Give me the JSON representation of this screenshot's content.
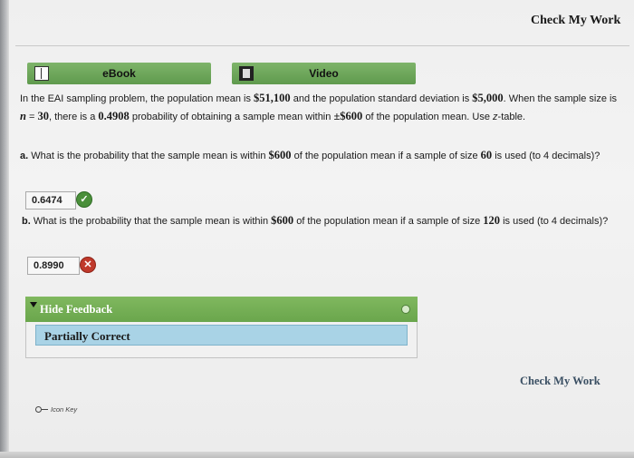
{
  "header": {
    "check_my_work": "Check My Work"
  },
  "resources": {
    "ebook": "eBook",
    "video": "Video"
  },
  "problem": {
    "intro_1": "In the EAI sampling problem, the population mean is ",
    "pop_mean": "$51,100",
    "intro_2": " and the population standard deviation is ",
    "pop_sd": "$5,000",
    "intro_3": ". When the sample size is ",
    "n_symbol": "n",
    "intro_4": " = ",
    "n_value": "30",
    "intro_5": ", there is a ",
    "prob": "0.4908",
    "intro_6": " probability of obtaining a sample mean within ",
    "range": "±$600",
    "intro_7": " of the population mean. Use ",
    "z": "z",
    "intro_8": "-table."
  },
  "question_a": {
    "prefix": "a.",
    "text_1": " What is the probability that the sample mean is within ",
    "amount": "$600",
    "text_2": " of the population mean if a sample of size ",
    "size": "60",
    "text_3": " is used (to 4 decimals)?",
    "answer": "0.6474",
    "status_icon": "check-circle-icon"
  },
  "question_b": {
    "prefix": "b.",
    "text_1": " What is the probability that the sample mean is within ",
    "amount": "$600",
    "text_2": " of the population mean if a sample of size ",
    "size": "120",
    "text_3": " is used (to 4 decimals)?",
    "answer": "0.8990",
    "status_icon": "x-circle-icon"
  },
  "feedback": {
    "toggle_label": "Hide Feedback",
    "message": "Partially Correct"
  },
  "footer": {
    "check_my_work": "Check My Work",
    "icon_key": "Icon Key"
  },
  "colors": {
    "resource_green": "#6aa64c",
    "feedback_blue": "#a9d3e6",
    "correct_green": "#4a8f3a",
    "incorrect_red": "#c0392b"
  }
}
